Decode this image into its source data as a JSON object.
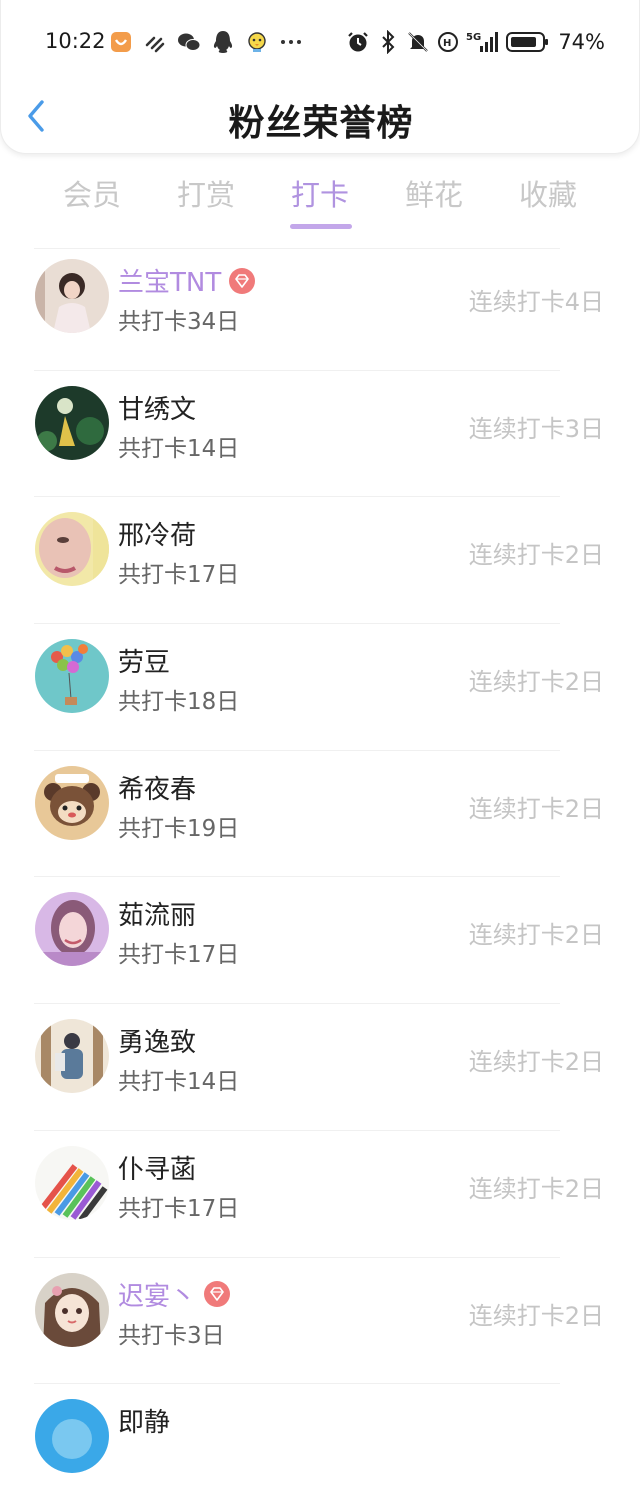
{
  "status_bar": {
    "time": "10:22",
    "battery": "74%",
    "left_icons": [
      "app-notification-icon",
      "link-icon",
      "wechat-icon",
      "qq-icon",
      "chick-icon",
      "more-dots-icon"
    ],
    "right_icons": [
      "alarm-icon",
      "bluetooth-icon",
      "mute-bell-icon",
      "hd-call-icon",
      "signal-5g-icon",
      "battery-icon"
    ]
  },
  "header": {
    "title": "粉丝荣誉榜",
    "back_icon": "chevron-left-icon"
  },
  "tabs": [
    {
      "label": "会员",
      "active": false
    },
    {
      "label": "打赏",
      "active": false
    },
    {
      "label": "打卡",
      "active": true
    },
    {
      "label": "鲜花",
      "active": false
    },
    {
      "label": "收藏",
      "active": false
    }
  ],
  "colors": {
    "accent": "#b093e0",
    "vip_name": "#b18be0",
    "vip_badge": "#f07a7a",
    "inactive_tab": "#c8c8c8",
    "streak_text": "#c5c5c5",
    "back_icon": "#4a9be8"
  },
  "rows": [
    {
      "name": "兰宝TNT",
      "vip": true,
      "total": "共打卡34日",
      "streak": "连续打卡4日"
    },
    {
      "name": "甘绣文",
      "vip": false,
      "total": "共打卡14日",
      "streak": "连续打卡3日"
    },
    {
      "name": "邢冷荷",
      "vip": false,
      "total": "共打卡17日",
      "streak": "连续打卡2日"
    },
    {
      "name": "劳豆",
      "vip": false,
      "total": "共打卡18日",
      "streak": "连续打卡2日"
    },
    {
      "name": "希夜春",
      "vip": false,
      "total": "共打卡19日",
      "streak": "连续打卡2日"
    },
    {
      "name": "茹流丽",
      "vip": false,
      "total": "共打卡17日",
      "streak": "连续打卡2日"
    },
    {
      "name": "勇逸致",
      "vip": false,
      "total": "共打卡14日",
      "streak": "连续打卡2日"
    },
    {
      "name": "仆寻菡",
      "vip": false,
      "total": "共打卡17日",
      "streak": "连续打卡2日"
    },
    {
      "name": "迟宴丶",
      "vip": true,
      "total": "共打卡3日",
      "streak": "连续打卡2日"
    },
    {
      "name": "即静",
      "vip": false,
      "total": "",
      "streak": ""
    }
  ]
}
